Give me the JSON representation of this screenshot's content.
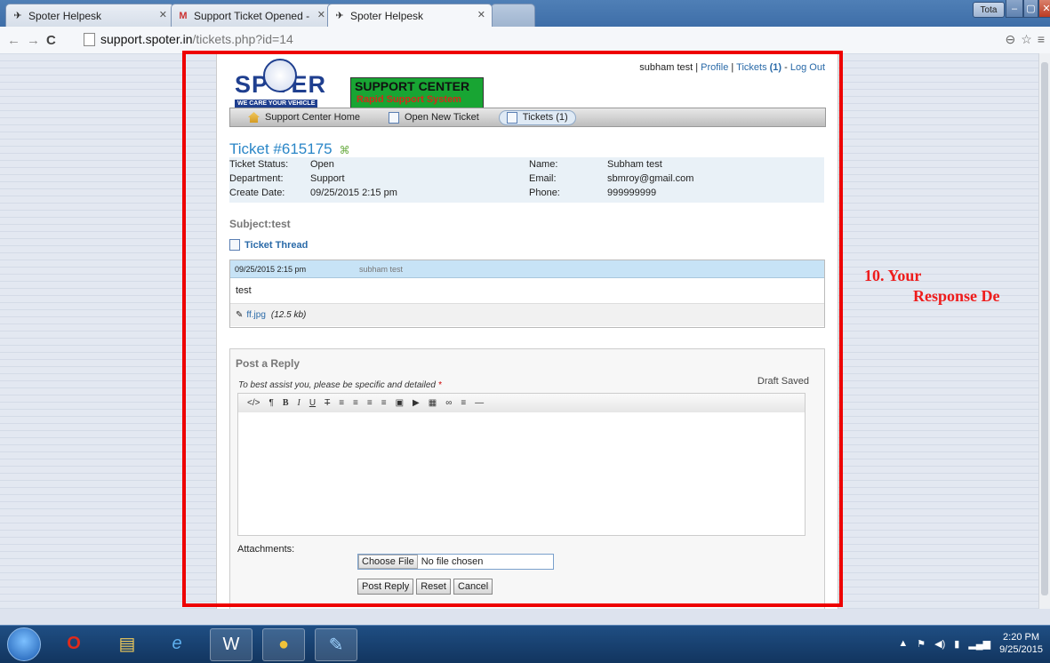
{
  "browser": {
    "tabs": [
      {
        "title": "Spoter Helpesk",
        "icon": "spoter-favicon"
      },
      {
        "title": "Support Ticket Opened - ",
        "icon": "gmail-icon"
      },
      {
        "title": "Spoter Helpesk",
        "icon": "spoter-favicon"
      }
    ],
    "user_badge": "Tota",
    "url_host": "support.spoter.in",
    "url_path": "/tickets.php?id=14"
  },
  "header": {
    "logo_main": "SP  TER",
    "logo_tagline": "WE CARE YOUR VEHICLE",
    "logo_box_title": "SUPPORT CENTER",
    "logo_box_subtitle": "Rapid Support System",
    "user_name": "subham test",
    "sep1": " | ",
    "link_profile": "Profile",
    "sep2": " | ",
    "link_tickets": "Tickets",
    "tickets_count": " (1)",
    "sep3": " - ",
    "link_logout": "Log Out"
  },
  "nav": {
    "home": "Support Center Home",
    "new_ticket": "Open New Ticket",
    "tickets": "Tickets (1)"
  },
  "ticket": {
    "title": "Ticket #615175",
    "refresh_glyph": "⌘",
    "status_label": "Ticket Status:",
    "status_value": "Open",
    "dept_label": "Department:",
    "dept_value": "Support",
    "created_label": "Create Date:",
    "created_value": "09/25/2015 2:15 pm",
    "name_label": "Name:",
    "name_value": "Subham test",
    "email_label": "Email:",
    "email_value": "sbmroy@gmail.com",
    "phone_label": "Phone:",
    "phone_value": "999999999",
    "subject": "Subject:test",
    "thread_title": "Ticket Thread",
    "thread": {
      "date": "09/25/2015 2:15 pm",
      "author": "subham test",
      "message": "test",
      "attachment_name": "ff.jpg",
      "attachment_size": "(12.5 kb)"
    }
  },
  "reply": {
    "title": "Post a Reply",
    "hint": "To best assist you, please be specific and detailed",
    "required_mark": "*",
    "draft_status": "Draft Saved",
    "toolbar": [
      "</>",
      "¶",
      "B",
      "I",
      "U",
      "T",
      "≡",
      "≡",
      "≡",
      "≡",
      "▣",
      "▶",
      "▦",
      "∞",
      "≡",
      "—"
    ],
    "attachments_label": "Attachments:",
    "choose_file": "Choose File",
    "no_file": "No file chosen",
    "post_button": "Post Reply",
    "reset_button": "Reset",
    "cancel_button": "Cancel"
  },
  "annotation": {
    "line1": "10. Your",
    "line2": "Response De"
  },
  "taskbar": {
    "time": "2:20 PM",
    "date": "9/25/2015"
  },
  "colors": {
    "annotation_red": "#ee0000",
    "link_blue": "#2a6aa8",
    "ticket_blue": "#2a86c7",
    "taskbar": "#1f4e83"
  }
}
